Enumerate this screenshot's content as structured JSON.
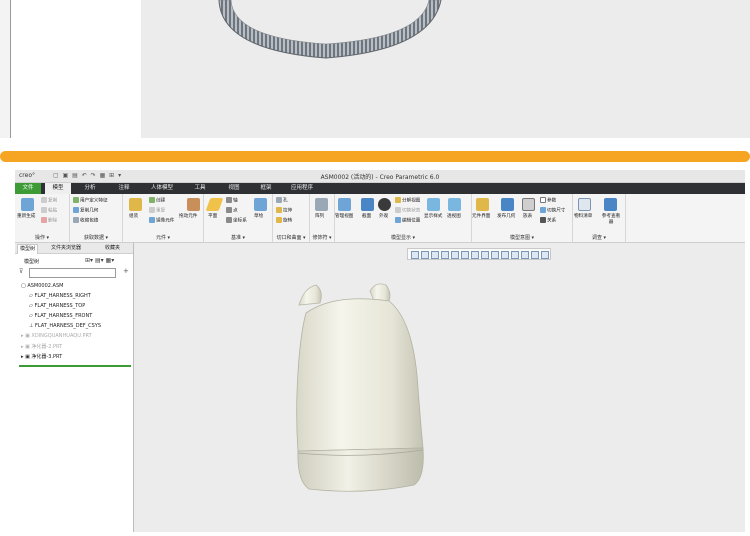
{
  "window": {
    "logo": "creo°",
    "title": "ASM0002 (活动的) - Creo Parametric 6.0"
  },
  "ribbon_tabs": [
    "文件",
    "模型",
    "分析",
    "注释",
    "人体模型",
    "工具",
    "视图",
    "框架",
    "应用程序"
  ],
  "active_tab": "模型",
  "ribbon": {
    "groups": [
      {
        "label": "操作 ▾",
        "items": [
          "重新生成",
          "复制",
          "粘贴",
          "删除"
        ]
      },
      {
        "label": "获取数据 ▾",
        "items": [
          "用户定义特征",
          "复制几何",
          "收缩包络"
        ]
      },
      {
        "label": "元件 ▾",
        "items": [
          "组装",
          "创建",
          "重复",
          "镜像元件",
          "拖动元件"
        ]
      },
      {
        "label": "基准 ▾",
        "items": [
          "平面",
          "轴",
          "点",
          "坐标系",
          "草绘"
        ]
      },
      {
        "label": "切口和曲面 ▾",
        "items": [
          "孔",
          "拉伸",
          "旋转"
        ]
      },
      {
        "label": "修饰符 ▾",
        "items": [
          "阵列"
        ]
      },
      {
        "label": "模型显示 ▾",
        "items": [
          "管理视图",
          "截面",
          "外观",
          "分解视图",
          "切换状态",
          "编辑位置",
          "显示样式",
          "透视图"
        ]
      },
      {
        "label": "模型意图 ▾",
        "items": [
          "元件界面",
          "发布几何",
          "族表",
          "参数",
          "切换尺寸",
          "关系"
        ]
      },
      {
        "label": "调查 ▾",
        "items": [
          "物料清单",
          "参考查看器"
        ]
      }
    ]
  },
  "panel": {
    "tabs": [
      "模型树",
      "文件夹浏览器",
      "收藏夹"
    ],
    "tree_title": "模型树",
    "tree": [
      {
        "label": "ASM0002.ASM",
        "style": "normal"
      },
      {
        "label": "FLAT_HARNESS_RIGHT",
        "style": "normal"
      },
      {
        "label": "FLAT_HARNESS_TOP",
        "style": "normal"
      },
      {
        "label": "FLAT_HARNESS_FRONT",
        "style": "normal"
      },
      {
        "label": "FLAT_HARNESS_DEF_CSYS",
        "style": "normal"
      },
      {
        "label": "XDINGQUANHUAQU.PRT",
        "style": "gray"
      },
      {
        "label": "净化器-2.PRT",
        "style": "gray"
      },
      {
        "label": "净化器-3.PRT",
        "style": "normal"
      }
    ]
  },
  "colors": {
    "accent_bar": "#f5a521",
    "file_tab": "#3d9b35",
    "ribbon_tabs_bg": "#2e3033",
    "model_body": "#efeee3",
    "ring": "#8d939a"
  },
  "icons": [
    "search-icon",
    "zoom-in-icon",
    "zoom-out-icon",
    "refit-icon",
    "repaint-icon",
    "view-orientation-icon",
    "display-style-icon",
    "datum-display-icon",
    "plane-icon",
    "axis-icon",
    "point-icon",
    "csys-icon",
    "sketch-icon",
    "hole-icon",
    "extrude-icon",
    "revolve-icon",
    "pattern-icon",
    "assemble-icon",
    "filter-icon",
    "add-icon"
  ]
}
